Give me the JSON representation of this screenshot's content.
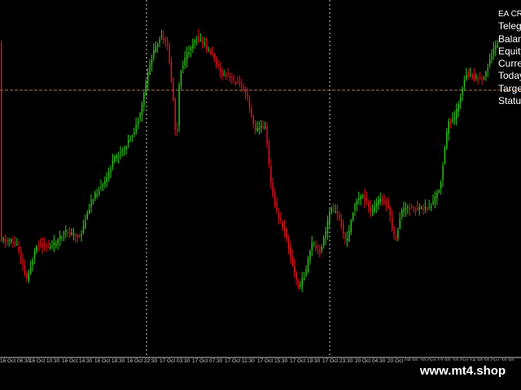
{
  "info_panel": {
    "lines": [
      "EA CR",
      "Teleg",
      "Balan",
      "Equity",
      "Curre",
      "Today",
      "Targe",
      "Status"
    ]
  },
  "time_axis": {
    "labels": [
      "16 Oct 06:30",
      "16 Oct 10:30",
      "16 Oct 14:30",
      "16 Oct 18:30",
      "16 Oct 22:30",
      "17 Oct 03:30",
      "17 Oct 07:30",
      "17 Oct 11:30",
      "17 Oct 15:30",
      "17 Oct 19:30",
      "17 Oct 23:30",
      "20 Oct 04:30",
      "20 Oct 08:30",
      "20 Oct 12:30",
      "20 Oct 16:30",
      "20 Oct 20:30"
    ]
  },
  "watermark": {
    "text": "www.mt4.shop"
  },
  "colors": {
    "background": "#000000",
    "bull_candle": "#32c81e",
    "bear_candle": "#e6141e",
    "grid_separator": "#c8c8c8",
    "price_line": "#b47850"
  }
}
